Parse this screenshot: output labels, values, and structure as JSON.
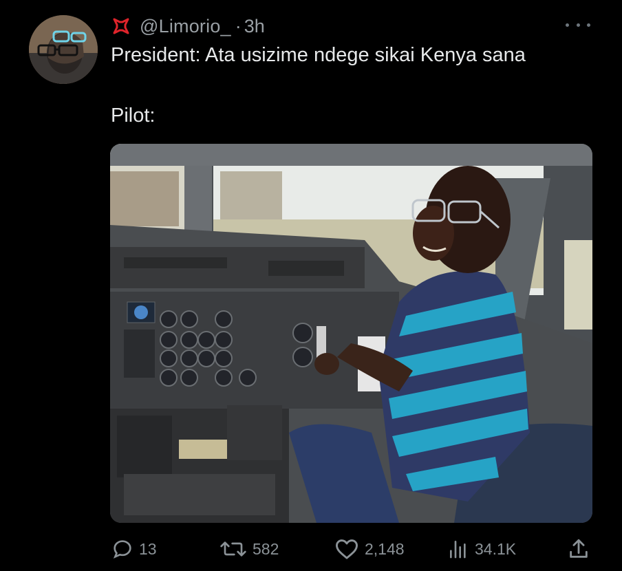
{
  "tweet": {
    "handle": "@Limorio_",
    "separator": "·",
    "time": "3h",
    "line1": "President: Ata usizime ndege sikai Kenya sana",
    "line2": "Pilot:",
    "badge_icon": "red-box-badge-icon",
    "more_icon": "more-dots-icon",
    "media_description_icon": "cockpit-photo"
  },
  "actions": {
    "replies": "13",
    "retweets": "582",
    "likes": "2,148",
    "views": "34.1K"
  },
  "colors": {
    "background": "#000000",
    "text": "#e7e9ea",
    "muted": "#8b9297",
    "badge_red": "#e0242b"
  }
}
